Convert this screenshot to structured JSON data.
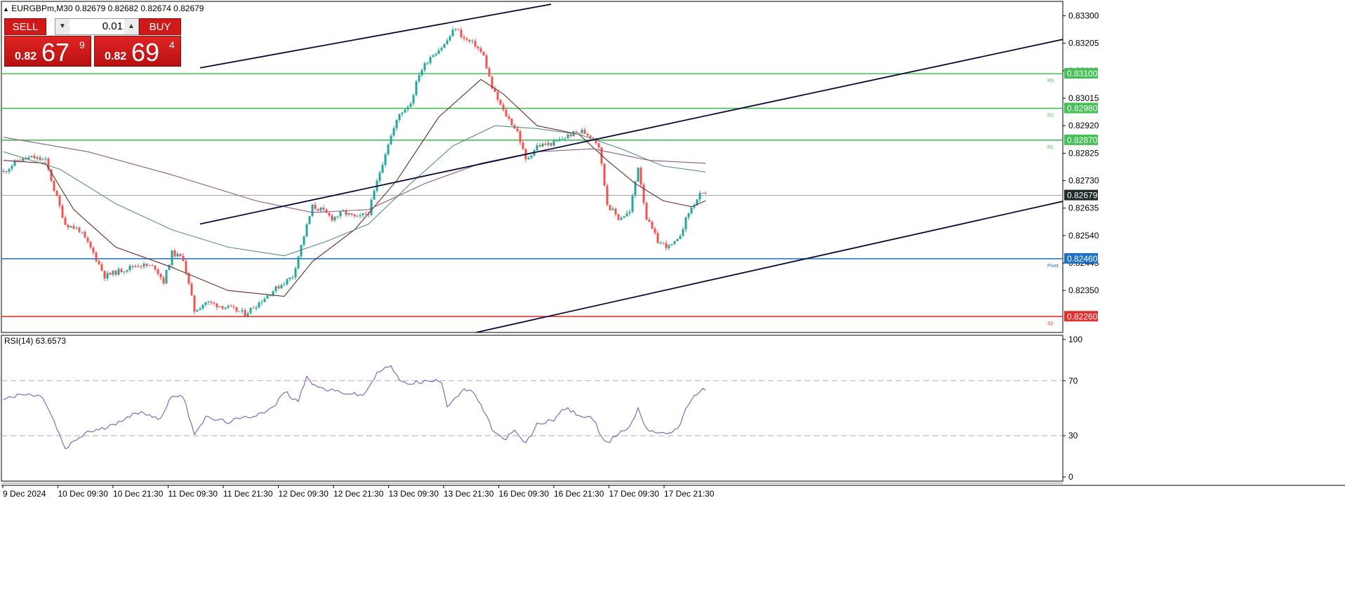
{
  "header": {
    "symbol_line": "EURGBPm,M30  0.82679 0.82682 0.82674 0.82679",
    "collapse_icon": "triangle-up-icon"
  },
  "trade_panel": {
    "sell_label": "SELL",
    "buy_label": "BUY",
    "lot_value": "0.01",
    "sell_price_prefix": "0.82",
    "sell_price_big": "67",
    "sell_price_sup": "9",
    "buy_price_prefix": "0.82",
    "buy_price_big": "69",
    "buy_price_sup": "4"
  },
  "colors": {
    "bull": "#26a69a",
    "bear": "#ef5350",
    "resistance": "#44c054",
    "pivot": "#1b6fc4",
    "support": "#e03030",
    "trend": "#0a0a3a",
    "ma_fast": "#6b2a2a",
    "ma_mid": "#5a8f84",
    "ma_slow": "#8c5a8c",
    "rsi": "#7d6bc0"
  },
  "chart_data": [
    {
      "type": "candlestick",
      "symbol": "EURGBPm",
      "timeframe": "M30",
      "ylim": [
        0.82205,
        0.83345
      ],
      "y_ticks": [
        "0.83300",
        "0.83205",
        "0.83110",
        "0.83015",
        "0.82920",
        "0.82825",
        "0.82730",
        "0.82635",
        "0.82540",
        "0.82445",
        "0.82350"
      ],
      "x_tick_labels": [
        "9 Dec 2024",
        "10 Dec 09:30",
        "10 Dec 21:30",
        "11 Dec 09:30",
        "11 Dec 21:30",
        "12 Dec 09:30",
        "12 Dec 21:30",
        "13 Dec 09:30",
        "13 Dec 21:30",
        "16 Dec 09:30",
        "16 Dec 21:30",
        "17 Dec 09:30",
        "17 Dec 21:30"
      ],
      "current_price": "0.82679",
      "close_path": [
        [
          0,
          0.8276
        ],
        [
          5,
          0.828
        ],
        [
          10,
          0.8281
        ],
        [
          15,
          0.828
        ],
        [
          18,
          0.827
        ],
        [
          22,
          0.8258
        ],
        [
          27,
          0.8256
        ],
        [
          32,
          0.8248
        ],
        [
          36,
          0.824
        ],
        [
          42,
          0.8242
        ],
        [
          48,
          0.8244
        ],
        [
          54,
          0.8243
        ],
        [
          57,
          0.8238
        ],
        [
          60,
          0.8248
        ],
        [
          64,
          0.8246
        ],
        [
          68,
          0.8228
        ],
        [
          72,
          0.8231
        ],
        [
          80,
          0.8229
        ],
        [
          86,
          0.8227
        ],
        [
          90,
          0.823
        ],
        [
          96,
          0.8235
        ],
        [
          103,
          0.824
        ],
        [
          107,
          0.8254
        ],
        [
          110,
          0.8264
        ],
        [
          113,
          0.8263
        ],
        [
          117,
          0.826
        ],
        [
          121,
          0.8262
        ],
        [
          126,
          0.826
        ],
        [
          130,
          0.8262
        ],
        [
          134,
          0.8276
        ],
        [
          137,
          0.8286
        ],
        [
          141,
          0.8296
        ],
        [
          145,
          0.83
        ],
        [
          148,
          0.831
        ],
        [
          152,
          0.8316
        ],
        [
          157,
          0.832
        ],
        [
          161,
          0.8326
        ],
        [
          164,
          0.8322
        ],
        [
          168,
          0.832
        ],
        [
          171,
          0.8316
        ],
        [
          174,
          0.8305
        ],
        [
          178,
          0.8297
        ],
        [
          183,
          0.829
        ],
        [
          186,
          0.828
        ],
        [
          190,
          0.8285
        ],
        [
          196,
          0.8286
        ],
        [
          202,
          0.8289
        ],
        [
          206,
          0.829
        ],
        [
          210,
          0.8288
        ],
        [
          212,
          0.8285
        ],
        [
          215,
          0.8265
        ],
        [
          219,
          0.826
        ],
        [
          223,
          0.8262
        ],
        [
          226,
          0.8278
        ],
        [
          229,
          0.826
        ],
        [
          233,
          0.8252
        ],
        [
          237,
          0.825
        ],
        [
          240,
          0.8252
        ],
        [
          244,
          0.8262
        ],
        [
          248,
          0.8268
        ],
        [
          250,
          0.82679
        ]
      ],
      "horizontal_levels": [
        {
          "label": "0.83100",
          "tag": "R3",
          "kind": "resistance",
          "value": 0.831
        },
        {
          "label": "0.82980",
          "tag": "R2",
          "kind": "resistance",
          "value": 0.8298
        },
        {
          "label": "0.82870",
          "tag": "R1",
          "kind": "resistance",
          "value": 0.8287
        },
        {
          "label": "0.82460",
          "tag": "Pivot",
          "kind": "pivot",
          "value": 0.8246
        },
        {
          "label": "0.82260",
          "tag": "S2",
          "kind": "support",
          "value": 0.8226
        }
      ],
      "trend_lines": [
        {
          "from": [
            70,
            0.8312
          ],
          "to": [
            195,
            0.8334
          ]
        },
        {
          "from": [
            70,
            0.8258
          ],
          "to": [
            378,
            0.8322
          ]
        },
        {
          "from": [
            166,
            0.822
          ],
          "to": [
            378,
            0.8266
          ]
        }
      ],
      "moving_averages": [
        {
          "kind": "fast",
          "points": [
            [
              0,
              0.828
            ],
            [
              15,
              0.8279
            ],
            [
              25,
              0.8263
            ],
            [
              40,
              0.825
            ],
            [
              60,
              0.8243
            ],
            [
              80,
              0.8235
            ],
            [
              100,
              0.8233
            ],
            [
              110,
              0.8245
            ],
            [
              125,
              0.8256
            ],
            [
              140,
              0.8273
            ],
            [
              155,
              0.8295
            ],
            [
              170,
              0.8308
            ],
            [
              178,
              0.8303
            ],
            [
              190,
              0.8292
            ],
            [
              205,
              0.8289
            ],
            [
              215,
              0.828
            ],
            [
              225,
              0.8272
            ],
            [
              235,
              0.8266
            ],
            [
              245,
              0.8264
            ],
            [
              250,
              0.8266
            ]
          ]
        },
        {
          "kind": "mid",
          "points": [
            [
              0,
              0.8283
            ],
            [
              20,
              0.8277
            ],
            [
              40,
              0.8265
            ],
            [
              60,
              0.8256
            ],
            [
              80,
              0.825
            ],
            [
              100,
              0.8247
            ],
            [
              115,
              0.8252
            ],
            [
              130,
              0.8258
            ],
            [
              145,
              0.8272
            ],
            [
              160,
              0.8285
            ],
            [
              175,
              0.8292
            ],
            [
              190,
              0.8291
            ],
            [
              205,
              0.8289
            ],
            [
              220,
              0.8284
            ],
            [
              235,
              0.8278
            ],
            [
              250,
              0.8276
            ]
          ]
        },
        {
          "kind": "slow",
          "points": [
            [
              0,
              0.8288
            ],
            [
              30,
              0.8283
            ],
            [
              60,
              0.8275
            ],
            [
              90,
              0.8266
            ],
            [
              110,
              0.8262
            ],
            [
              130,
              0.8263
            ],
            [
              150,
              0.8272
            ],
            [
              170,
              0.8279
            ],
            [
              190,
              0.8283
            ],
            [
              210,
              0.8284
            ],
            [
              230,
              0.828
            ],
            [
              250,
              0.8279
            ]
          ]
        }
      ]
    },
    {
      "type": "line",
      "indicator_label": "RSI(14) 63.6573",
      "ylim": [
        0,
        100
      ],
      "y_ticks": [
        "100",
        "70",
        "30",
        "0"
      ],
      "levels": [
        70,
        30
      ],
      "points": [
        [
          0,
          57
        ],
        [
          8,
          60
        ],
        [
          14,
          58
        ],
        [
          18,
          40
        ],
        [
          22,
          20
        ],
        [
          26,
          27
        ],
        [
          30,
          33
        ],
        [
          34,
          34
        ],
        [
          38,
          37
        ],
        [
          44,
          44
        ],
        [
          50,
          47
        ],
        [
          56,
          42
        ],
        [
          60,
          60
        ],
        [
          64,
          58
        ],
        [
          68,
          32
        ],
        [
          72,
          43
        ],
        [
          80,
          40
        ],
        [
          88,
          44
        ],
        [
          96,
          50
        ],
        [
          100,
          62
        ],
        [
          105,
          55
        ],
        [
          108,
          74
        ],
        [
          111,
          66
        ],
        [
          116,
          63
        ],
        [
          122,
          61
        ],
        [
          128,
          59
        ],
        [
          134,
          78
        ],
        [
          138,
          80
        ],
        [
          142,
          68
        ],
        [
          148,
          69
        ],
        [
          156,
          70
        ],
        [
          158,
          52
        ],
        [
          164,
          64
        ],
        [
          168,
          60
        ],
        [
          174,
          35
        ],
        [
          178,
          27
        ],
        [
          182,
          33
        ],
        [
          186,
          24
        ],
        [
          190,
          38
        ],
        [
          196,
          42
        ],
        [
          200,
          50
        ],
        [
          206,
          44
        ],
        [
          210,
          42
        ],
        [
          212,
          34
        ],
        [
          215,
          24
        ],
        [
          219,
          32
        ],
        [
          223,
          36
        ],
        [
          226,
          50
        ],
        [
          229,
          35
        ],
        [
          235,
          31
        ],
        [
          240,
          35
        ],
        [
          244,
          53
        ],
        [
          248,
          63
        ],
        [
          250,
          63.66
        ]
      ]
    }
  ]
}
